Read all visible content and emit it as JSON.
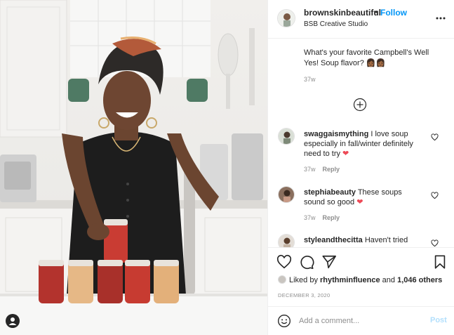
{
  "header": {
    "username": "brownskinbeautiful",
    "follow_label": "Follow",
    "location": "BSB Creative Studio",
    "more_icon": "more-horizontal-icon"
  },
  "caption": {
    "text": "What's your favorite Campbell's Well Yes! Soup flavor? 👩🏾👩🏾",
    "time": "37w"
  },
  "comments": [
    {
      "user": "swaggaismything",
      "text": "I love soup especially in fall/winter definitely need to try",
      "heart": "❤",
      "time": "37w",
      "reply": "Reply"
    },
    {
      "user": "stephiabeauty",
      "text": "These soups sound so good",
      "heart": "❤",
      "time": "37w",
      "reply": "Reply"
    },
    {
      "user": "styleandthecitta",
      "text": "Haven't tried"
    }
  ],
  "likes": {
    "prefix": "Liked by ",
    "user": "rhythminfluence",
    "middle": " and ",
    "count": "1,046 others"
  },
  "date": "DECEMBER 3, 2020",
  "add_comment": {
    "placeholder": "Add a comment...",
    "post_label": "Post"
  },
  "colors": {
    "accent": "#0095f6",
    "like_red": "#ed4956",
    "muted": "#8e8e8e",
    "post_disabled": "#b2dffc"
  }
}
